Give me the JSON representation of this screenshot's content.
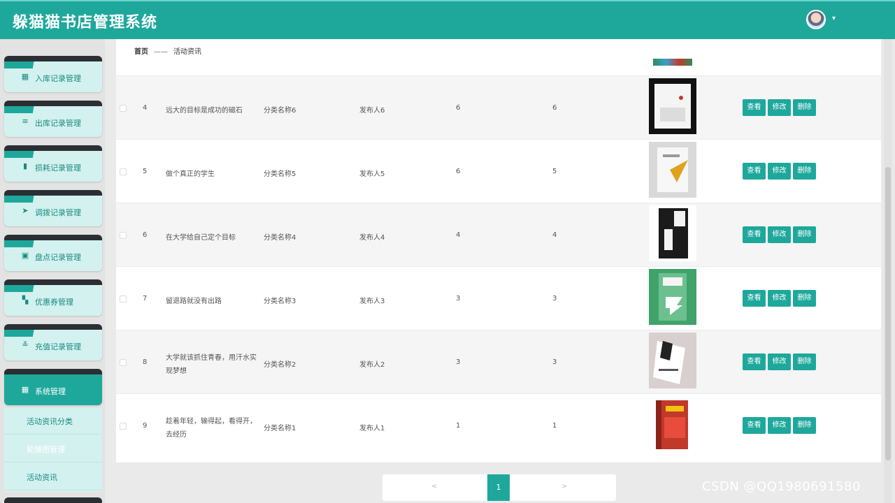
{
  "header": {
    "title": "躲猫猫书店管理系统",
    "avatar_caret": "▾"
  },
  "sidebar": {
    "items": [
      {
        "icon": "▦",
        "label": "入库记录管理"
      },
      {
        "icon": "≡",
        "label": "出库记录管理"
      },
      {
        "icon": "▮",
        "label": "损耗记录管理"
      },
      {
        "icon": "➤",
        "label": "调拨记录管理"
      },
      {
        "icon": "▣",
        "label": "盘点记录管理"
      },
      {
        "icon": "▚",
        "label": "优惠券管理"
      },
      {
        "icon": "≚",
        "label": "充值记录管理"
      },
      {
        "icon": "▦",
        "label": "系统管理"
      }
    ],
    "submenu": [
      "活动资讯分类",
      "轮播图管理",
      "活动资讯"
    ]
  },
  "breadcrumb": {
    "home": "首页",
    "sep": "——",
    "current": "活动资讯"
  },
  "table": {
    "rows": [
      {
        "index": "4",
        "title": "远大的目标是成功的磁石",
        "category": "分类名称6",
        "publisher": "发布人6",
        "col5": "6",
        "col6": "6"
      },
      {
        "index": "5",
        "title": "做个真正的学生",
        "category": "分类名称5",
        "publisher": "发布人5",
        "col5": "6",
        "col6": "5"
      },
      {
        "index": "6",
        "title": "在大学给自己定个目标",
        "category": "分类名称4",
        "publisher": "发布人4",
        "col5": "4",
        "col6": "4"
      },
      {
        "index": "7",
        "title": "留退路就没有出路",
        "category": "分类名称3",
        "publisher": "发布人3",
        "col5": "3",
        "col6": "3"
      },
      {
        "index": "8",
        "title": "大学就该抓住青春，用汗水实现梦想",
        "category": "分类名称2",
        "publisher": "发布人2",
        "col5": "3",
        "col6": "3"
      },
      {
        "index": "9",
        "title": "趁着年轻，输得起，看得开，去经历",
        "category": "分类名称1",
        "publisher": "发布人1",
        "col5": "1",
        "col6": "1"
      }
    ],
    "actions": {
      "view": "查看",
      "edit": "修改",
      "delete": "删除"
    }
  },
  "pagination": {
    "prev": "<",
    "page": "1",
    "next": ">"
  },
  "watermark": "CSDN @QQ1980691580",
  "colors": {
    "accent": "#1ea89c",
    "sidebar_bg": "#d3f1ef",
    "dark_band": "#2b2f33"
  }
}
